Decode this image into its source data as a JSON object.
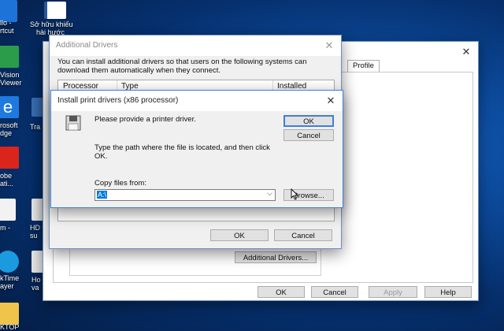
{
  "desktop": {
    "icons": [
      {
        "label1": "llo -",
        "label2": "rtcut"
      },
      {
        "label1": "Sở hữu khiếu",
        "label2": "hài hước"
      },
      {
        "label1": "Vision",
        "label2": "Viewer"
      },
      {
        "label1": "rosoft",
        "label2": "dge"
      },
      {
        "label1": "Tra",
        "label2": ""
      },
      {
        "label1": "obe",
        "label2": "ati..."
      },
      {
        "label1": "m -",
        "label2": ""
      },
      {
        "label1": "HD",
        "label2": "su"
      },
      {
        "label1": "kTime",
        "label2": "ayer"
      },
      {
        "label1": "Ho",
        "label2": "va"
      },
      {
        "label1": "KTOP",
        "label2": ""
      }
    ],
    "colors": {
      "accent": "#0d4ea3",
      "highlight": "#3f7fd6"
    }
  },
  "properties_window": {
    "tab_profile": "Profile",
    "additional_drivers_button": "Additional Drivers...",
    "ok": "OK",
    "cancel": "Cancel",
    "apply": "Apply",
    "help": "Help"
  },
  "additional_drivers": {
    "title": "Additional Drivers",
    "description": "You can install additional drivers so that users on the following systems can download them automatically when they connect.",
    "columns": [
      "Processor",
      "Type",
      "Installed"
    ],
    "ok": "OK",
    "cancel": "Cancel"
  },
  "install_dialog": {
    "title": "Install print drivers (x86 processor)",
    "prompt": "Please provide a printer driver.",
    "instructions": "Type the path where the file is located, and then click OK.",
    "copy_label": "Copy files from:",
    "copy_value": "A:\\",
    "ok": "OK",
    "cancel": "Cancel",
    "browse": "Browse..."
  }
}
